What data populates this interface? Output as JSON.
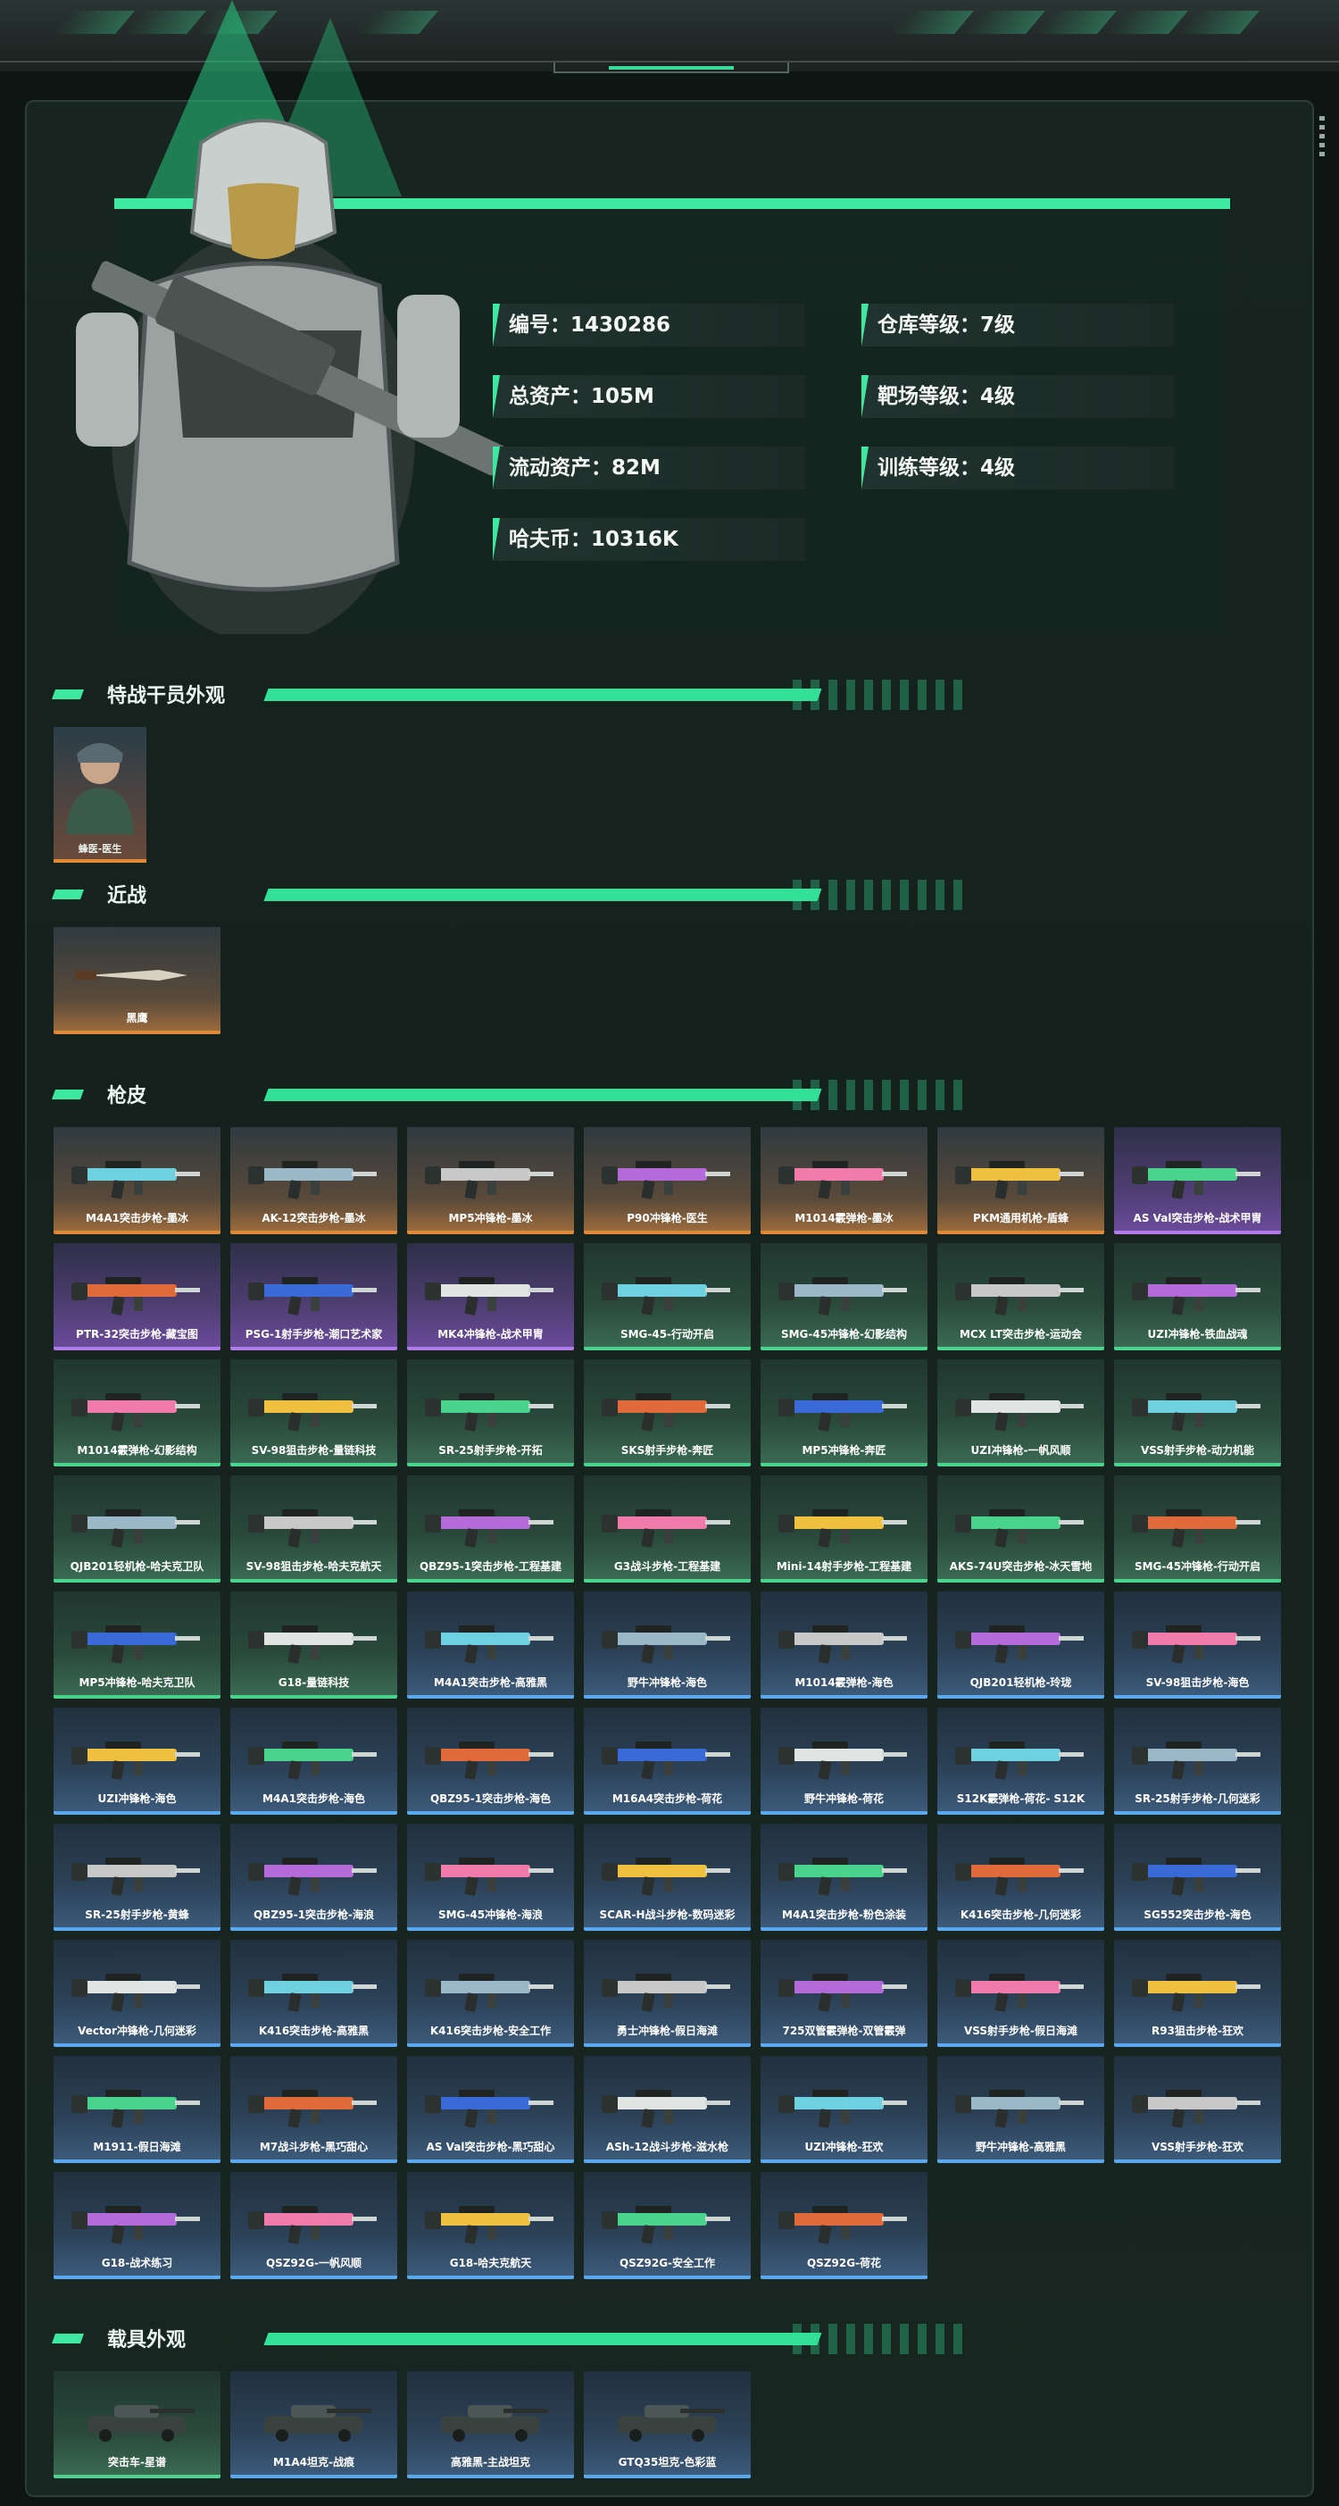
{
  "stats": {
    "id": "编号：1430286",
    "total_assets": "总资产：105M",
    "liquid_assets": "流动资产：82M",
    "havcoin": "哈夫币：10316K",
    "warehouse": "仓库等级：7级",
    "range": "靶场等级：4级",
    "training": "训练等级：4级"
  },
  "sections": {
    "operators": "特战干员外观",
    "melee": "近战",
    "skins": "枪皮",
    "vehicles": "载具外观"
  },
  "operators": [
    {
      "label": "蜂医-医生"
    }
  ],
  "melee": [
    {
      "label": "黑鹰"
    }
  ],
  "skins": [
    {
      "label": "M4A1突击步枪-墨冰",
      "tier": "gold"
    },
    {
      "label": "AK-12突击步枪-墨冰",
      "tier": "gold"
    },
    {
      "label": "MP5冲锋枪-墨冰",
      "tier": "gold"
    },
    {
      "label": "P90冲锋枪-医生",
      "tier": "gold"
    },
    {
      "label": "M1014霰弹枪-墨冰",
      "tier": "gold"
    },
    {
      "label": "PKM通用机枪-盾蜂",
      "tier": "gold"
    },
    {
      "label": "AS Val突击步枪-战术甲胄",
      "tier": "purple"
    },
    {
      "label": "PTR-32突击步枪-藏宝图",
      "tier": "purple"
    },
    {
      "label": "PSG-1射手步枪-潮口艺术家",
      "tier": "purple"
    },
    {
      "label": "MK4冲锋枪-战术甲胄",
      "tier": "purple"
    },
    {
      "label": "SMG-45-行动开启",
      "tier": "green"
    },
    {
      "label": "SMG-45冲锋枪-幻影结构",
      "tier": "green"
    },
    {
      "label": "MCX LT突击步枪-运动会",
      "tier": "green"
    },
    {
      "label": "UZI冲锋枪-铁血战魂",
      "tier": "green"
    },
    {
      "label": "M1014霰弹枪-幻影结构",
      "tier": "green"
    },
    {
      "label": "SV-98狙击步枪-量链科技",
      "tier": "green"
    },
    {
      "label": "SR-25射手步枪-开拓",
      "tier": "green"
    },
    {
      "label": "SKS射手步枪-奔匠",
      "tier": "green"
    },
    {
      "label": "MP5冲锋枪-奔匠",
      "tier": "green"
    },
    {
      "label": "UZI冲锋枪-一帆风顺",
      "tier": "green"
    },
    {
      "label": "VSS射手步枪-动力机能",
      "tier": "green"
    },
    {
      "label": "QJB201轻机枪-哈夫克卫队",
      "tier": "green"
    },
    {
      "label": "SV-98狙击步枪-哈夫克航天",
      "tier": "green"
    },
    {
      "label": "QBZ95-1突击步枪-工程基建",
      "tier": "green"
    },
    {
      "label": "G3战斗步枪-工程基建",
      "tier": "green"
    },
    {
      "label": "Mini-14射手步枪-工程基建",
      "tier": "green"
    },
    {
      "label": "AKS-74U突击步枪-冰天雪地",
      "tier": "green"
    },
    {
      "label": "SMG-45冲锋枪-行动开启",
      "tier": "green"
    },
    {
      "label": "MP5冲锋枪-哈夫克卫队",
      "tier": "green"
    },
    {
      "label": "G18-量链科技",
      "tier": "green"
    },
    {
      "label": "M4A1突击步枪-高雅黑",
      "tier": "blue"
    },
    {
      "label": "野牛冲锋枪-海色",
      "tier": "blue"
    },
    {
      "label": "M1014霰弹枪-海色",
      "tier": "blue"
    },
    {
      "label": "QJB201轻机枪-玲珑",
      "tier": "blue"
    },
    {
      "label": "SV-98狙击步枪-海色",
      "tier": "blue"
    },
    {
      "label": "UZI冲锋枪-海色",
      "tier": "blue"
    },
    {
      "label": "M4A1突击步枪-海色",
      "tier": "blue"
    },
    {
      "label": "QBZ95-1突击步枪-海色",
      "tier": "blue"
    },
    {
      "label": "M16A4突击步枪-荷花",
      "tier": "blue"
    },
    {
      "label": "野牛冲锋枪-荷花",
      "tier": "blue"
    },
    {
      "label": "S12K霰弹枪-荷花- S12K",
      "tier": "blue"
    },
    {
      "label": "SR-25射手步枪-几何迷彩",
      "tier": "blue"
    },
    {
      "label": "SR-25射手步枪-黄蜂",
      "tier": "blue"
    },
    {
      "label": "QBZ95-1突击步枪-海浪",
      "tier": "blue"
    },
    {
      "label": "SMG-45冲锋枪-海浪",
      "tier": "blue"
    },
    {
      "label": "SCAR-H战斗步枪-数码迷彩",
      "tier": "blue"
    },
    {
      "label": "M4A1突击步枪-粉色涂装",
      "tier": "blue"
    },
    {
      "label": "K416突击步枪-几何迷彩",
      "tier": "blue"
    },
    {
      "label": "SG552突击步枪-海色",
      "tier": "blue"
    },
    {
      "label": "Vector冲锋枪-几何迷彩",
      "tier": "blue"
    },
    {
      "label": "K416突击步枪-高雅黑",
      "tier": "blue"
    },
    {
      "label": "K416突击步枪-安全工作",
      "tier": "blue"
    },
    {
      "label": "勇士冲锋枪-假日海滩",
      "tier": "blue"
    },
    {
      "label": "725双管霰弹枪-双管霰弹",
      "tier": "blue"
    },
    {
      "label": "VSS射手步枪-假日海滩",
      "tier": "blue"
    },
    {
      "label": "R93狙击步枪-狂欢",
      "tier": "blue"
    },
    {
      "label": "M1911-假日海滩",
      "tier": "blue"
    },
    {
      "label": "M7战斗步枪-黑巧甜心",
      "tier": "blue"
    },
    {
      "label": "AS Val突击步枪-黑巧甜心",
      "tier": "blue"
    },
    {
      "label": "ASh-12战斗步枪-滋水枪",
      "tier": "blue"
    },
    {
      "label": "UZI冲锋枪-狂欢",
      "tier": "blue"
    },
    {
      "label": "野牛冲锋枪-高雅黑",
      "tier": "blue"
    },
    {
      "label": "VSS射手步枪-狂欢",
      "tier": "blue"
    },
    {
      "label": "G18-战术练习",
      "tier": "blue"
    },
    {
      "label": "QSZ92G-一帆风顺",
      "tier": "blue"
    },
    {
      "label": "G18-哈夫克航天",
      "tier": "blue"
    },
    {
      "label": "QSZ92G-安全工作",
      "tier": "blue"
    },
    {
      "label": "QSZ92G-荷花",
      "tier": "blue"
    }
  ],
  "vehicles": [
    {
      "label": "突击车-星谱",
      "tier": "green"
    },
    {
      "label": "M1A4坦克-战痕",
      "tier": "blue"
    },
    {
      "label": "高雅黑-主战坦克",
      "tier": "blue"
    },
    {
      "label": "GTQ35坦克-色彩蓝",
      "tier": "blue"
    }
  ],
  "colors": {
    "accent": "#3ee8a0",
    "gold": "#e08a38",
    "purple": "#b07ae8",
    "green": "#4ad38c",
    "blue": "#5aa8f0"
  }
}
